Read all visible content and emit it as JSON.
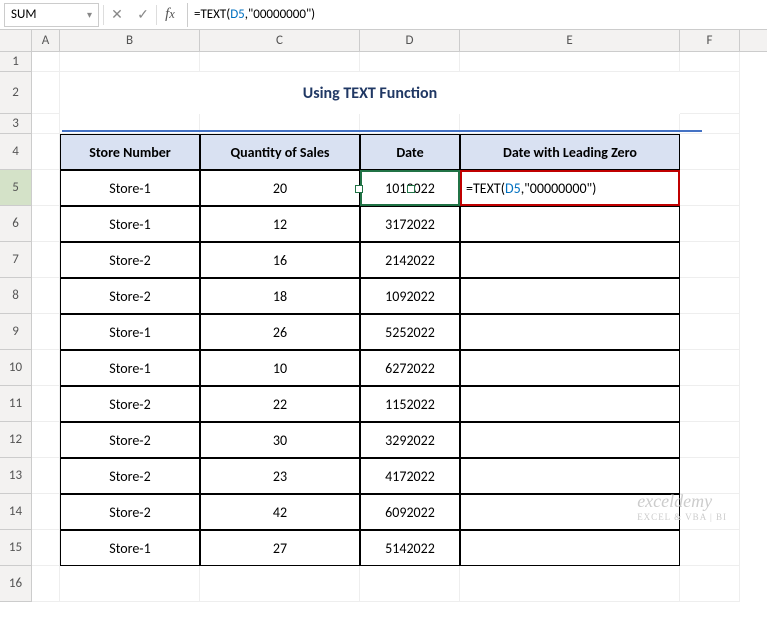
{
  "formula_bar": {
    "name_box": "SUM",
    "formula_plain": "=TEXT(D5,\"00000000\")",
    "formula_prefix": "=TEXT(",
    "formula_ref": "D5",
    "formula_suffix": ",\"00000000\")"
  },
  "columns": [
    "A",
    "B",
    "C",
    "D",
    "E",
    "F"
  ],
  "row_numbers": [
    "1",
    "2",
    "3",
    "4",
    "5",
    "6",
    "7",
    "8",
    "9",
    "10",
    "11",
    "12",
    "13",
    "14",
    "15",
    "16"
  ],
  "title": "Using TEXT Function",
  "headers": {
    "store": "Store Number",
    "qty": "Quantity of Sales",
    "date": "Date",
    "datez": "Date with Leading Zero"
  },
  "active_cell": {
    "ref": "D5",
    "row": 5,
    "col": "D"
  },
  "editing_cell": {
    "ref": "E5",
    "row": 5,
    "col": "E"
  },
  "cell_formula": {
    "prefix": "=TEXT(",
    "ref": "D5",
    "suffix": ",\"00000000\")"
  },
  "watermark": {
    "brand": "exceldemy",
    "tagline": "EXCEL & VBA | BI"
  },
  "chart_data": {
    "type": "table",
    "columns": [
      "Store Number",
      "Quantity of Sales",
      "Date",
      "Date with Leading Zero"
    ],
    "rows": [
      {
        "store": "Store-1",
        "qty": 20,
        "date": 1012022,
        "datez": ""
      },
      {
        "store": "Store-1",
        "qty": 12,
        "date": 3172022,
        "datez": ""
      },
      {
        "store": "Store-2",
        "qty": 16,
        "date": 2142022,
        "datez": ""
      },
      {
        "store": "Store-2",
        "qty": 18,
        "date": 1092022,
        "datez": ""
      },
      {
        "store": "Store-1",
        "qty": 26,
        "date": 5252022,
        "datez": ""
      },
      {
        "store": "Store-1",
        "qty": 10,
        "date": 6272022,
        "datez": ""
      },
      {
        "store": "Store-2",
        "qty": 22,
        "date": 1152022,
        "datez": ""
      },
      {
        "store": "Store-2",
        "qty": 30,
        "date": 3292022,
        "datez": ""
      },
      {
        "store": "Store-2",
        "qty": 23,
        "date": 4172022,
        "datez": ""
      },
      {
        "store": "Store-2",
        "qty": 42,
        "date": 6092022,
        "datez": ""
      },
      {
        "store": "Store-1",
        "qty": 27,
        "date": 5142022,
        "datez": ""
      }
    ]
  }
}
